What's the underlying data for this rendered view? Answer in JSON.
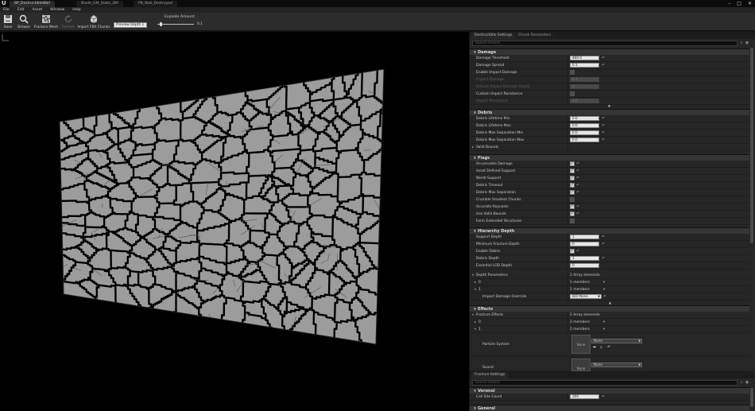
{
  "title_bar": {
    "tabs": [
      "BP_DestructibleWall",
      "Blade_GM_Static_DM",
      "PB_Wall_Destroyed"
    ],
    "window_controls": [
      "minimize",
      "maximize",
      "close"
    ]
  },
  "menu": [
    "File",
    "Edit",
    "Asset",
    "Window",
    "Help"
  ],
  "toolbar": {
    "buttons": [
      {
        "label": "Save",
        "icon": "save-icon",
        "enabled": true
      },
      {
        "label": "Browse",
        "icon": "browse-icon",
        "enabled": true
      },
      {
        "label": "Fracture Mesh",
        "icon": "fracture-icon",
        "enabled": true
      },
      {
        "label": "Refresh",
        "icon": "refresh-icon",
        "enabled": false
      },
      {
        "label": "Import FBX Chunks",
        "icon": "import-icon",
        "enabled": true
      }
    ],
    "preview_depth": "Preview Depth 1",
    "explode_label": "Explode Amount",
    "explode_value": "0.1",
    "explode_fraction": 0.1
  },
  "details_panel": {
    "tabs": [
      "Destructible Settings",
      "Chunk Parameters"
    ],
    "search_placeholder": "Search Details",
    "damage": {
      "header": "Damage",
      "rows": [
        {
          "label": "Damage Threshold",
          "value": "400.0"
        },
        {
          "label": "Damage Spread",
          "value": "0.1"
        },
        {
          "label": "Enable Impact Damage"
        },
        {
          "label": "Impact Damage",
          "value": "0.1"
        },
        {
          "label": "Default Impact Damage Depth",
          "value": "0"
        },
        {
          "label": "Custom Impact Resistance"
        },
        {
          "label": "Impact Resistance",
          "value": "1.0"
        }
      ]
    },
    "debris": {
      "header": "Debris",
      "rows": [
        {
          "label": "Debris Lifetime Min",
          "value": "0.0"
        },
        {
          "label": "Debris Lifetime Max",
          "value": "0.0"
        },
        {
          "label": "Debris Max Separation Min",
          "value": "0.0"
        },
        {
          "label": "Debris Max Separation Max",
          "value": "0.0"
        },
        {
          "label": "Valid Bounds"
        }
      ]
    },
    "flags": {
      "header": "Flags",
      "rows": [
        {
          "label": "Accumulate Damage",
          "checked": true
        },
        {
          "label": "Asset Defined Support",
          "checked": true
        },
        {
          "label": "World Support",
          "checked": true
        },
        {
          "label": "Debris Timeout",
          "checked": true
        },
        {
          "label": "Debris Max Separation",
          "checked": true
        },
        {
          "label": "Crumble Smallest Chunks",
          "checked": false
        },
        {
          "label": "Accurate Raycasts",
          "checked": true
        },
        {
          "label": "Use Valid Bounds",
          "checked": true
        },
        {
          "label": "Form Extended Structures",
          "checked": false
        }
      ]
    },
    "hierarchy": {
      "header": "Hierarchy Depth",
      "rows": [
        {
          "label": "Support Depth",
          "value": "1"
        },
        {
          "label": "Minimum Fracture Depth",
          "value": "0"
        },
        {
          "label": "Enable Debris",
          "checked": true
        },
        {
          "label": "Debris Depth",
          "value": "1"
        },
        {
          "label": "Essential LOD Depth",
          "value": "0"
        }
      ],
      "depth_params": {
        "label": "Depth Parameters",
        "count": "2 Array elements",
        "items": [
          {
            "index": "0",
            "value": "1 members"
          },
          {
            "index": "1",
            "value": "1 members"
          }
        ],
        "impact_override_label": "Impact Damage Override",
        "impact_override_value": "IDO None"
      }
    },
    "effects": {
      "header": "Effects",
      "fracture_effects_label": "Fracture Effects",
      "fracture_effects_count": "2 Array elements",
      "items": [
        {
          "index": "0",
          "value": "2 members"
        },
        {
          "index": "1",
          "value": "2 members"
        }
      ],
      "particle_system_label": "Particle System",
      "particle_system_value": "None",
      "sound_label": "Sound",
      "sound_value": "None",
      "thumb_text": "None"
    }
  },
  "fracture_panel": {
    "tab": "Fracture Settings",
    "search_placeholder": "Search Details",
    "voronoi_header": "Voronoi",
    "cell_site_label": "Cell Site Count",
    "cell_site_value": "200",
    "general_header": "General"
  },
  "colors": {
    "bg": "#151515",
    "panel": "#262626",
    "section": "#353535",
    "mesh_face": "#9c9c9c",
    "crack": "#000000"
  }
}
